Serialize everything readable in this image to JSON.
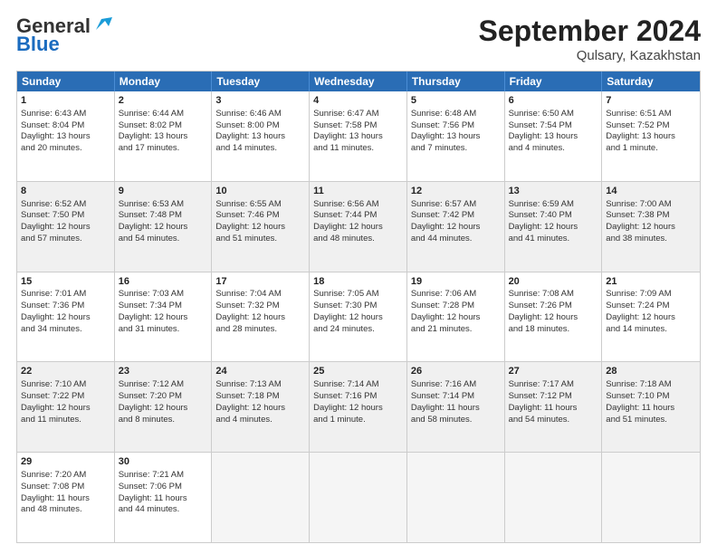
{
  "header": {
    "logo_line1": "General",
    "logo_line2": "Blue",
    "month": "September 2024",
    "location": "Qulsary, Kazakhstan"
  },
  "days_of_week": [
    "Sunday",
    "Monday",
    "Tuesday",
    "Wednesday",
    "Thursday",
    "Friday",
    "Saturday"
  ],
  "weeks": [
    [
      {
        "day": "1",
        "lines": [
          "Sunrise: 6:43 AM",
          "Sunset: 8:04 PM",
          "Daylight: 13 hours",
          "and 20 minutes."
        ],
        "shade": false
      },
      {
        "day": "2",
        "lines": [
          "Sunrise: 6:44 AM",
          "Sunset: 8:02 PM",
          "Daylight: 13 hours",
          "and 17 minutes."
        ],
        "shade": false
      },
      {
        "day": "3",
        "lines": [
          "Sunrise: 6:46 AM",
          "Sunset: 8:00 PM",
          "Daylight: 13 hours",
          "and 14 minutes."
        ],
        "shade": false
      },
      {
        "day": "4",
        "lines": [
          "Sunrise: 6:47 AM",
          "Sunset: 7:58 PM",
          "Daylight: 13 hours",
          "and 11 minutes."
        ],
        "shade": false
      },
      {
        "day": "5",
        "lines": [
          "Sunrise: 6:48 AM",
          "Sunset: 7:56 PM",
          "Daylight: 13 hours",
          "and 7 minutes."
        ],
        "shade": false
      },
      {
        "day": "6",
        "lines": [
          "Sunrise: 6:50 AM",
          "Sunset: 7:54 PM",
          "Daylight: 13 hours",
          "and 4 minutes."
        ],
        "shade": false
      },
      {
        "day": "7",
        "lines": [
          "Sunrise: 6:51 AM",
          "Sunset: 7:52 PM",
          "Daylight: 13 hours",
          "and 1 minute."
        ],
        "shade": false
      }
    ],
    [
      {
        "day": "8",
        "lines": [
          "Sunrise: 6:52 AM",
          "Sunset: 7:50 PM",
          "Daylight: 12 hours",
          "and 57 minutes."
        ],
        "shade": true
      },
      {
        "day": "9",
        "lines": [
          "Sunrise: 6:53 AM",
          "Sunset: 7:48 PM",
          "Daylight: 12 hours",
          "and 54 minutes."
        ],
        "shade": true
      },
      {
        "day": "10",
        "lines": [
          "Sunrise: 6:55 AM",
          "Sunset: 7:46 PM",
          "Daylight: 12 hours",
          "and 51 minutes."
        ],
        "shade": true
      },
      {
        "day": "11",
        "lines": [
          "Sunrise: 6:56 AM",
          "Sunset: 7:44 PM",
          "Daylight: 12 hours",
          "and 48 minutes."
        ],
        "shade": true
      },
      {
        "day": "12",
        "lines": [
          "Sunrise: 6:57 AM",
          "Sunset: 7:42 PM",
          "Daylight: 12 hours",
          "and 44 minutes."
        ],
        "shade": true
      },
      {
        "day": "13",
        "lines": [
          "Sunrise: 6:59 AM",
          "Sunset: 7:40 PM",
          "Daylight: 12 hours",
          "and 41 minutes."
        ],
        "shade": true
      },
      {
        "day": "14",
        "lines": [
          "Sunrise: 7:00 AM",
          "Sunset: 7:38 PM",
          "Daylight: 12 hours",
          "and 38 minutes."
        ],
        "shade": true
      }
    ],
    [
      {
        "day": "15",
        "lines": [
          "Sunrise: 7:01 AM",
          "Sunset: 7:36 PM",
          "Daylight: 12 hours",
          "and 34 minutes."
        ],
        "shade": false
      },
      {
        "day": "16",
        "lines": [
          "Sunrise: 7:03 AM",
          "Sunset: 7:34 PM",
          "Daylight: 12 hours",
          "and 31 minutes."
        ],
        "shade": false
      },
      {
        "day": "17",
        "lines": [
          "Sunrise: 7:04 AM",
          "Sunset: 7:32 PM",
          "Daylight: 12 hours",
          "and 28 minutes."
        ],
        "shade": false
      },
      {
        "day": "18",
        "lines": [
          "Sunrise: 7:05 AM",
          "Sunset: 7:30 PM",
          "Daylight: 12 hours",
          "and 24 minutes."
        ],
        "shade": false
      },
      {
        "day": "19",
        "lines": [
          "Sunrise: 7:06 AM",
          "Sunset: 7:28 PM",
          "Daylight: 12 hours",
          "and 21 minutes."
        ],
        "shade": false
      },
      {
        "day": "20",
        "lines": [
          "Sunrise: 7:08 AM",
          "Sunset: 7:26 PM",
          "Daylight: 12 hours",
          "and 18 minutes."
        ],
        "shade": false
      },
      {
        "day": "21",
        "lines": [
          "Sunrise: 7:09 AM",
          "Sunset: 7:24 PM",
          "Daylight: 12 hours",
          "and 14 minutes."
        ],
        "shade": false
      }
    ],
    [
      {
        "day": "22",
        "lines": [
          "Sunrise: 7:10 AM",
          "Sunset: 7:22 PM",
          "Daylight: 12 hours",
          "and 11 minutes."
        ],
        "shade": true
      },
      {
        "day": "23",
        "lines": [
          "Sunrise: 7:12 AM",
          "Sunset: 7:20 PM",
          "Daylight: 12 hours",
          "and 8 minutes."
        ],
        "shade": true
      },
      {
        "day": "24",
        "lines": [
          "Sunrise: 7:13 AM",
          "Sunset: 7:18 PM",
          "Daylight: 12 hours",
          "and 4 minutes."
        ],
        "shade": true
      },
      {
        "day": "25",
        "lines": [
          "Sunrise: 7:14 AM",
          "Sunset: 7:16 PM",
          "Daylight: 12 hours",
          "and 1 minute."
        ],
        "shade": true
      },
      {
        "day": "26",
        "lines": [
          "Sunrise: 7:16 AM",
          "Sunset: 7:14 PM",
          "Daylight: 11 hours",
          "and 58 minutes."
        ],
        "shade": true
      },
      {
        "day": "27",
        "lines": [
          "Sunrise: 7:17 AM",
          "Sunset: 7:12 PM",
          "Daylight: 11 hours",
          "and 54 minutes."
        ],
        "shade": true
      },
      {
        "day": "28",
        "lines": [
          "Sunrise: 7:18 AM",
          "Sunset: 7:10 PM",
          "Daylight: 11 hours",
          "and 51 minutes."
        ],
        "shade": true
      }
    ],
    [
      {
        "day": "29",
        "lines": [
          "Sunrise: 7:20 AM",
          "Sunset: 7:08 PM",
          "Daylight: 11 hours",
          "and 48 minutes."
        ],
        "shade": false
      },
      {
        "day": "30",
        "lines": [
          "Sunrise: 7:21 AM",
          "Sunset: 7:06 PM",
          "Daylight: 11 hours",
          "and 44 minutes."
        ],
        "shade": false
      },
      {
        "day": "",
        "lines": [],
        "shade": false,
        "empty": true
      },
      {
        "day": "",
        "lines": [],
        "shade": false,
        "empty": true
      },
      {
        "day": "",
        "lines": [],
        "shade": false,
        "empty": true
      },
      {
        "day": "",
        "lines": [],
        "shade": false,
        "empty": true
      },
      {
        "day": "",
        "lines": [],
        "shade": false,
        "empty": true
      }
    ]
  ]
}
